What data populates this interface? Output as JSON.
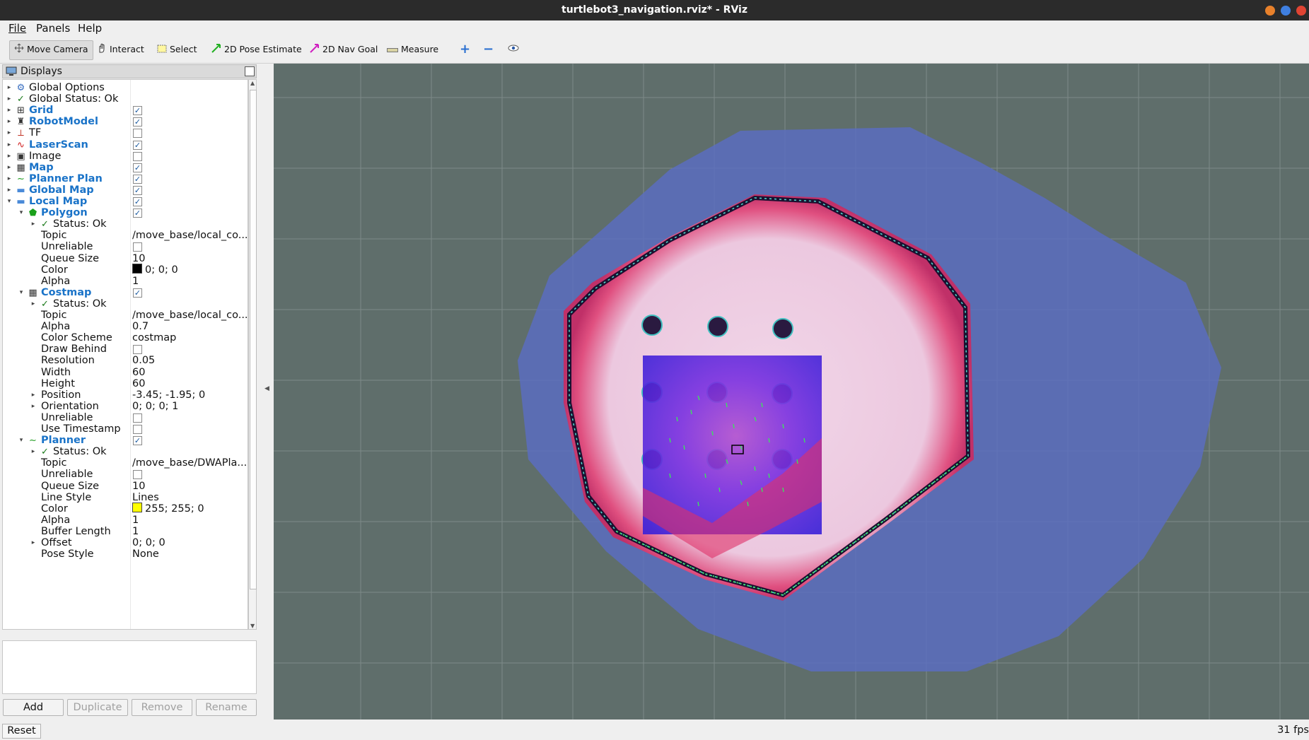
{
  "window": {
    "title": "turtlebot3_navigation.rviz* - RViz"
  },
  "menu": {
    "file": "File",
    "panels": "Panels",
    "help": "Help"
  },
  "toolbar": {
    "move_camera": "Move Camera",
    "interact": "Interact",
    "select": "Select",
    "pose_estimate": "2D Pose Estimate",
    "nav_goal": "2D Nav Goal",
    "measure": "Measure"
  },
  "displays_panel": {
    "title": "Displays",
    "rows": [
      {
        "label": "Global Options",
        "icon": "gear-icon"
      },
      {
        "label": "Global Status: Ok",
        "icon": "check-icon"
      },
      {
        "label": "Grid",
        "icon": "grid-icon",
        "checked": true
      },
      {
        "label": "RobotModel",
        "icon": "robot-icon",
        "checked": true
      },
      {
        "label": "TF",
        "icon": "axes-icon",
        "checked": false
      },
      {
        "label": "LaserScan",
        "icon": "laser-icon",
        "checked": true
      },
      {
        "label": "Image",
        "icon": "image-icon",
        "checked": false
      },
      {
        "label": "Map",
        "icon": "map-icon",
        "checked": true
      },
      {
        "label": "Planner Plan",
        "icon": "path-icon",
        "checked": true
      },
      {
        "label": "Global Map",
        "icon": "folder-icon",
        "checked": true
      },
      {
        "label": "Local Map",
        "icon": "folder-icon",
        "checked": true
      },
      {
        "label": "Polygon",
        "icon": "polygon-icon",
        "checked": true
      },
      {
        "label": "Status: Ok",
        "icon": "check-icon"
      },
      {
        "label": "Topic",
        "value": "/move_base/local_co..."
      },
      {
        "label": "Unreliable",
        "checked": false
      },
      {
        "label": "Queue Size",
        "value": "10"
      },
      {
        "label": "Color",
        "value": "0; 0; 0",
        "swatch": "#000000"
      },
      {
        "label": "Alpha",
        "value": "1"
      },
      {
        "label": "Costmap",
        "icon": "map-icon",
        "checked": true
      },
      {
        "label": "Status: Ok",
        "icon": "check-icon"
      },
      {
        "label": "Topic",
        "value": "/move_base/local_co..."
      },
      {
        "label": "Alpha",
        "value": "0.7"
      },
      {
        "label": "Color Scheme",
        "value": "costmap"
      },
      {
        "label": "Draw Behind",
        "checked": false
      },
      {
        "label": "Resolution",
        "value": "0.05"
      },
      {
        "label": "Width",
        "value": "60"
      },
      {
        "label": "Height",
        "value": "60"
      },
      {
        "label": "Position",
        "value": "-3.45; -1.95; 0"
      },
      {
        "label": "Orientation",
        "value": "0; 0; 0; 1"
      },
      {
        "label": "Unreliable",
        "checked": false
      },
      {
        "label": "Use Timestamp",
        "checked": false
      },
      {
        "label": "Planner",
        "icon": "path-icon",
        "checked": true
      },
      {
        "label": "Status: Ok",
        "icon": "check-icon"
      },
      {
        "label": "Topic",
        "value": "/move_base/DWAPla..."
      },
      {
        "label": "Unreliable",
        "checked": false
      },
      {
        "label": "Queue Size",
        "value": "10"
      },
      {
        "label": "Line Style",
        "value": "Lines"
      },
      {
        "label": "Color",
        "value": "255; 255; 0",
        "swatch": "#ffff00"
      },
      {
        "label": "Alpha",
        "value": "1"
      },
      {
        "label": "Buffer Length",
        "value": "1"
      },
      {
        "label": "Offset",
        "value": "0; 0; 0"
      },
      {
        "label": "Pose Style",
        "value": "None"
      }
    ]
  },
  "buttons": {
    "add": "Add",
    "duplicate": "Duplicate",
    "remove": "Remove",
    "rename": "Rename"
  },
  "status": {
    "reset": "Reset",
    "fps": "31 fps"
  },
  "colors": {
    "viewport_bg": "#5f6e6b",
    "accent": "#1a73c8"
  }
}
